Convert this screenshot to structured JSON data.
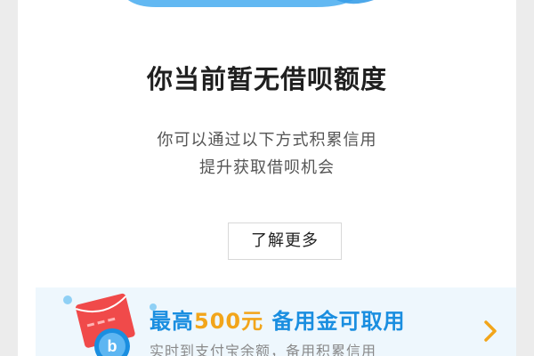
{
  "main": {
    "title": "你当前暂无借呗额度",
    "description_line1": "你可以通过以下方式积累信用",
    "description_line2": "提升获取借呗机会",
    "learn_more_label": "了解更多"
  },
  "promo": {
    "title_prefix": "最高",
    "title_amount": "500元",
    "title_suffix": "备用金可取用",
    "subtitle": "实时到支付宝余额，备用积累信用",
    "icon": "red-envelope-coin-icon",
    "arrow_icon": "chevron-right-icon"
  },
  "colors": {
    "accent_blue": "#1a8ee0",
    "accent_orange": "#f2a51a",
    "envelope_red": "#f04a4a"
  }
}
